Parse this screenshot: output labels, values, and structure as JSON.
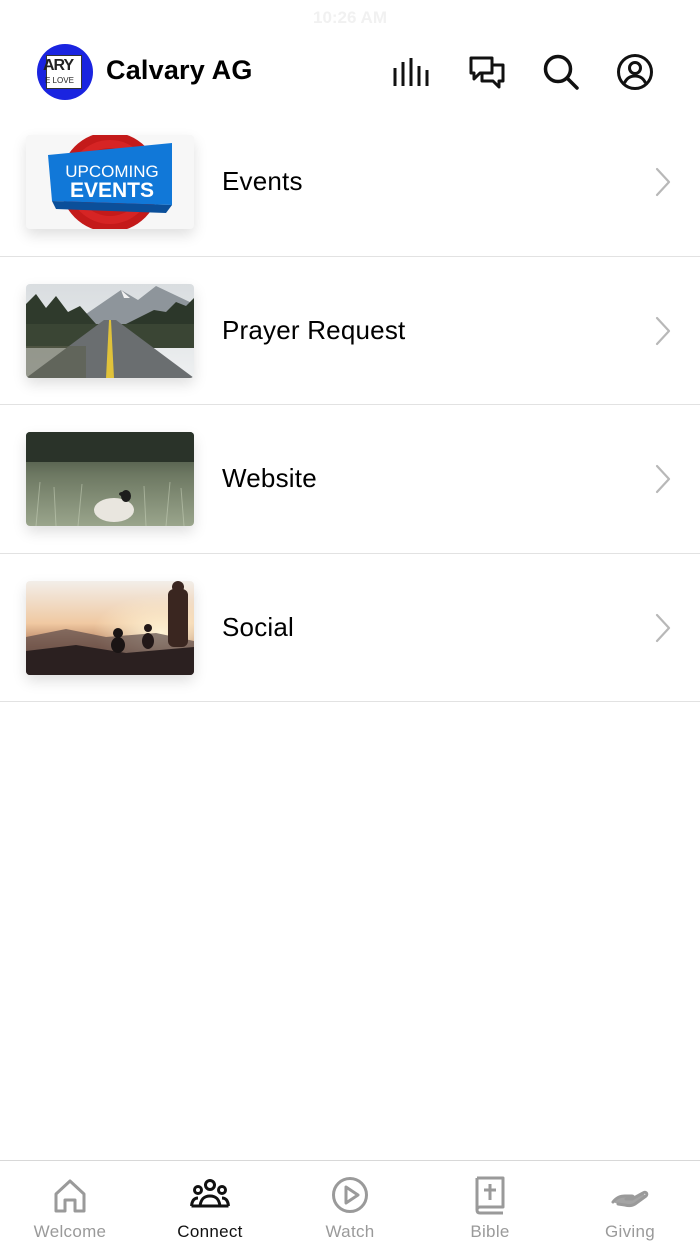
{
  "status": {
    "time": "10:26 AM"
  },
  "app": {
    "title": "Calvary AG",
    "logo_text_top": "ARY",
    "logo_text_bottom": "E LOVE",
    "logo_color": "#1a24e0"
  },
  "header_icons": [
    "audio-bars-icon",
    "chat-icon",
    "search-icon",
    "profile-icon"
  ],
  "items": [
    {
      "label": "Events",
      "thumb_text_1": "UPCOMING",
      "thumb_text_2": "EVENTS"
    },
    {
      "label": "Prayer Request"
    },
    {
      "label": "Website"
    },
    {
      "label": "Social"
    }
  ],
  "tabs": [
    {
      "label": "Welcome",
      "icon": "home-icon",
      "active": false
    },
    {
      "label": "Connect",
      "icon": "group-icon",
      "active": true
    },
    {
      "label": "Watch",
      "icon": "play-icon",
      "active": false
    },
    {
      "label": "Bible",
      "icon": "bible-icon",
      "active": false
    },
    {
      "label": "Giving",
      "icon": "giving-hand-icon",
      "active": false
    }
  ],
  "colors": {
    "divider": "#e2e2e2",
    "inactive_tab": "#9a9a9a",
    "active_tab": "#111111"
  }
}
